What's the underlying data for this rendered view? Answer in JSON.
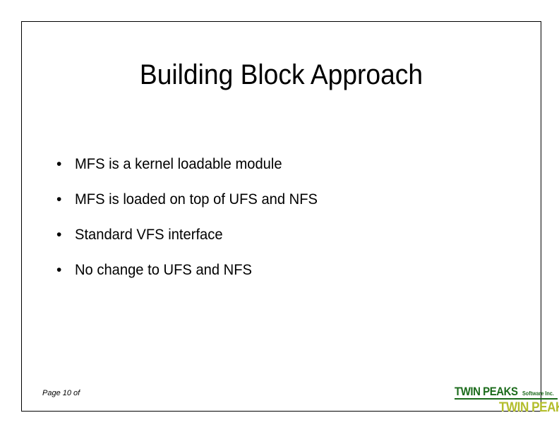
{
  "slide": {
    "title": "Building Block Approach",
    "bullet_marker": "•",
    "bullets": [
      {
        "text": "MFS is a kernel loadable module"
      },
      {
        "text": "MFS is loaded on top of UFS and NFS"
      },
      {
        "text": "Standard VFS interface"
      },
      {
        "text": "No change to UFS and NFS"
      }
    ],
    "footer": {
      "page_label": "Page 10 of"
    },
    "logos": {
      "primary": {
        "main_text": "TWIN PEAKS",
        "sub_text": "Software Inc.",
        "color": "#1b6b1b"
      },
      "secondary": {
        "text": "TWIN PEAKS",
        "color": "#b3bd2b"
      }
    },
    "colors": {
      "background": "#ffffff",
      "text": "#000000",
      "frame": "#000000"
    }
  }
}
